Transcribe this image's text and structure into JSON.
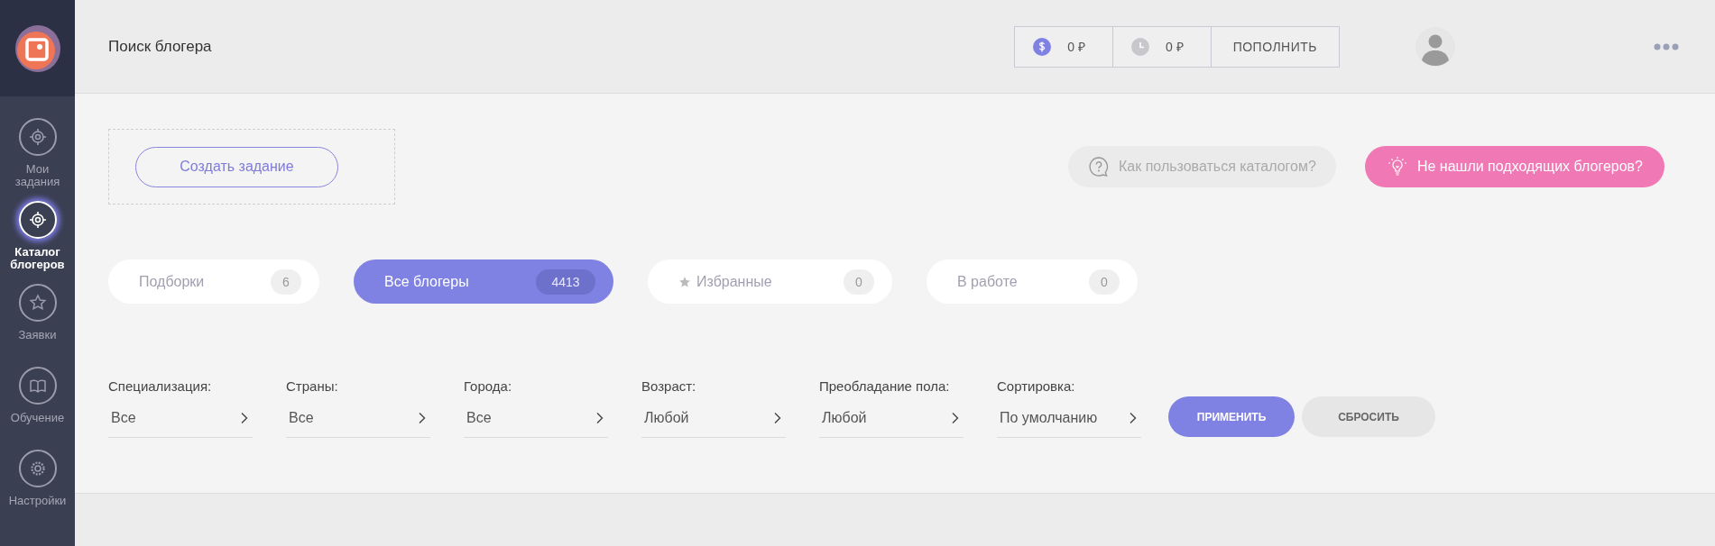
{
  "sidebar": {
    "items": [
      {
        "label": "Мои задания",
        "selected": false
      },
      {
        "label": "Каталог блогеров",
        "selected": true
      },
      {
        "label": "Заявки",
        "selected": false
      },
      {
        "label": "Обучение",
        "selected": false
      },
      {
        "label": "Настройки",
        "selected": false
      }
    ]
  },
  "header": {
    "title": "Поиск блогера",
    "balance": "0 ₽",
    "bonus": "0 ₽",
    "top_up_button": "ПОПОЛНИТЬ"
  },
  "create_task_button": "Создать задание",
  "help_button": "Как пользоваться каталогом?",
  "not_found_button": "Не нашли подходящих блогеров?",
  "tabs": [
    {
      "label": "Подборки",
      "count": "6",
      "selected": false,
      "star": false
    },
    {
      "label": "Все блогеры",
      "count": "4413",
      "selected": true,
      "star": false
    },
    {
      "label": "Избранные",
      "count": "0",
      "selected": false,
      "star": true
    },
    {
      "label": "В работе",
      "count": "0",
      "selected": false,
      "star": false
    }
  ],
  "filters": [
    {
      "label": "Специализация:",
      "value": "Все"
    },
    {
      "label": "Страны:",
      "value": "Все"
    },
    {
      "label": "Города:",
      "value": "Все"
    },
    {
      "label": "Возраст:",
      "value": "Любой"
    },
    {
      "label": "Преобладание пола:",
      "value": "Любой"
    },
    {
      "label": "Сортировка:",
      "value": "По умолчанию"
    }
  ],
  "apply_button": "ПРИМЕНИТЬ",
  "reset_button": "СБРОСИТЬ"
}
